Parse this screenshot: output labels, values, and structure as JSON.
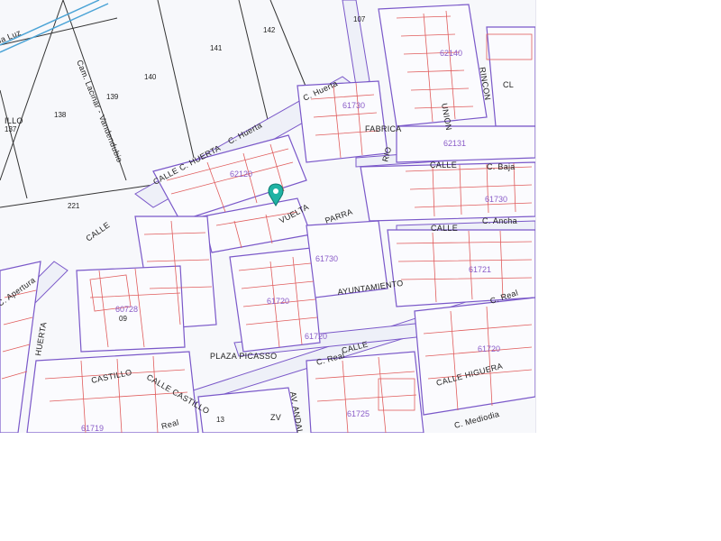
{
  "map": {
    "colors": {
      "background": "#f7f8fb",
      "block_outline": "#7a58c9",
      "parcel_outline": "#e05c5c",
      "road_fill": "#eef0f8",
      "water_line": "#4aa3d6",
      "marker": "#1fb3a4",
      "label": "#222222",
      "block_label": "#8a5cc8"
    },
    "marker_icon": "map-pin-icon",
    "streets": {
      "c_huerta_top": "C. Huerta",
      "c_huerta_mid": "C. Huerta",
      "calle_huerta": "CALLE C. HUERTA",
      "c_real_right": "C. Real",
      "c_real_mid": "C. Real",
      "real_bottom": "Real",
      "c_ancha": "C. Ancha",
      "c_mediodia": "C. Mediodia",
      "calle_higuera": "CALLE HIGUERA",
      "camino_vandedubio": "Cam. Lacinar - Vandendubio",
      "plaza": "PLAZA PICASSO",
      "ayuntamiento": "AYUNTAMIENTO",
      "calle_vuelta": "VUELTA",
      "calle_parra": "PARRA",
      "calle_fabrica": "FABRICA",
      "calle_rio": "RIO",
      "calle_rincon": "RINCON",
      "calle_union": "UNION",
      "calle_castillo": "CASTILLO",
      "calle_castillo2": "CALLE CASTILLO",
      "calle_generic_1": "CALLE",
      "calle_generic_2": "CALLE",
      "calle_generic_3": "CALLE",
      "calle_generic_4": "CALLE",
      "calle_baja": "C. Baja",
      "la_luz": "la Luz",
      "huerta_left": "HUERTA",
      "aperturas": "C. Apertura",
      "av_andalucia": "AV. ANDAL",
      "zv": "ZV",
      "castillo_hill": "ILLO",
      "c_fra": "CL"
    },
    "parcel_numbers": {
      "p141": "141",
      "p142": "142",
      "p140": "140",
      "p139": "139",
      "p138": "138",
      "p137": "137",
      "p221": "221",
      "p107": "107",
      "p13": "13",
      "p09": "09"
    },
    "block_numbers": {
      "b1": "62140",
      "b2": "62131",
      "b3": "61730",
      "b4": "62120",
      "b5": "60728",
      "b6": "61721",
      "b7": "61730",
      "b8": "61720",
      "b9": "61720",
      "b10": "61725",
      "b11": "61720",
      "b12": "61730",
      "b13": "61719"
    }
  }
}
